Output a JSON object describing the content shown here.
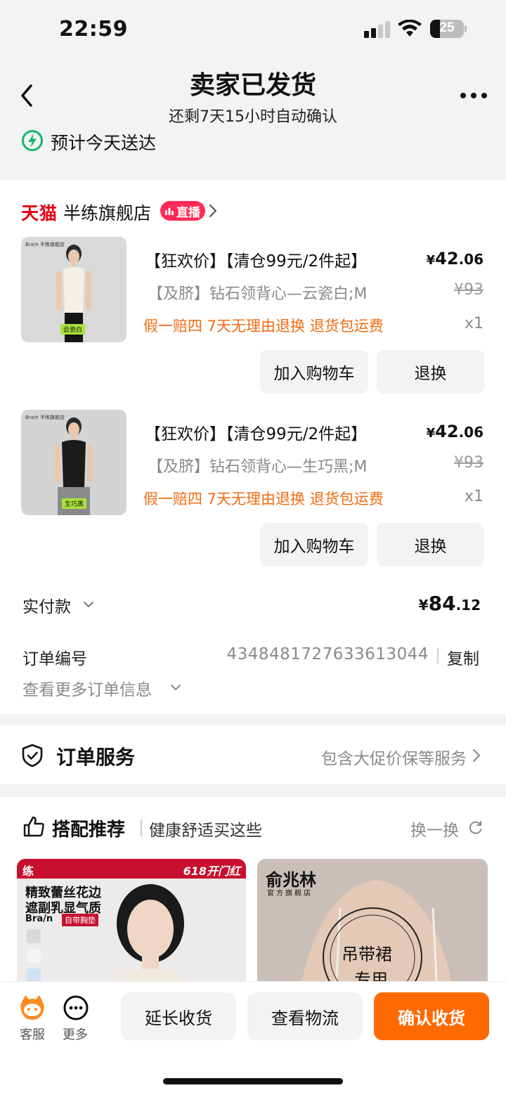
{
  "status_bar": {
    "time": "22:59",
    "battery": "25"
  },
  "header": {
    "title": "卖家已发货",
    "subtitle": "还剩7天15小时自动确认",
    "eta": "预计今天送达"
  },
  "store": {
    "brand": "天猫",
    "name": "半练旗舰店",
    "live_badge": "直播"
  },
  "products": [
    {
      "title": "【狂欢价】【清仓99元/2件起】",
      "price_currency": "¥",
      "price_int": "42",
      "price_dec": ".06",
      "sku": "【及脐】钻石领背心—云瓷白;M",
      "original_price": "¥93",
      "tags": "假一赔四  7天无理由退换  退货包运费",
      "qty": "x1",
      "btn_cart": "加入购物车",
      "btn_return": "退换",
      "thumb_brand": "Bra/n 半练旗舰店",
      "thumb_label": "云瓷白"
    },
    {
      "title": "【狂欢价】【清仓99元/2件起】",
      "price_currency": "¥",
      "price_int": "42",
      "price_dec": ".06",
      "sku": "【及脐】钻石领背心—生巧黑;M",
      "original_price": "¥93",
      "tags": "假一赔四  7天无理由退换  退货包运费",
      "qty": "x1",
      "btn_cart": "加入购物车",
      "btn_return": "退换",
      "thumb_brand": "Bra/n 半练旗舰店",
      "thumb_label": "生巧黑"
    }
  ],
  "payment": {
    "label": "实付款",
    "currency": "¥",
    "amount_int": "84",
    "amount_dec": ".12"
  },
  "order": {
    "label": "订单编号",
    "number": "4348481727633613044",
    "copy": "复制",
    "more_info": "查看更多订单信息"
  },
  "service": {
    "title": "订单服务",
    "detail": "包含大促价保等服务"
  },
  "recommend": {
    "title": "搭配推荐",
    "subtitle": "健康舒适买这些",
    "swap": "换一换",
    "card1": {
      "banner": "618开门红",
      "line1": "精致蕾丝花边",
      "line2": "遮副乳显气质",
      "brand": "Bra/n",
      "tag": "自带胸垫"
    },
    "card2": {
      "brand": "俞兆林",
      "brand_sub": "官方旗舰店",
      "stamp": "吊带裙",
      "stamp2": "专用"
    }
  },
  "bottom_bar": {
    "service": "客服",
    "more": "更多",
    "extend": "延长收货",
    "logistics": "查看物流",
    "confirm": "确认收货"
  },
  "colors": {
    "accent_orange": "#ff6a00",
    "tag_orange": "#f26b10",
    "tmall_red": "#e60012",
    "live_pink": "#ff2a55",
    "eta_green": "#14b86b"
  }
}
